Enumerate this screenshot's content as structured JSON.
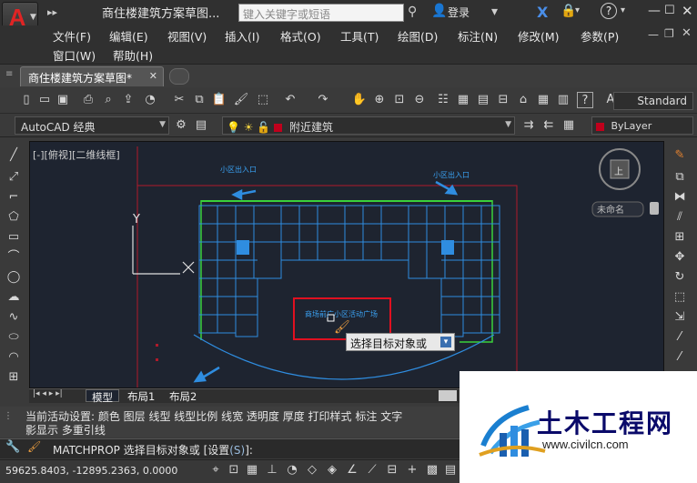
{
  "titlebar": {
    "doc_title": "商住楼建筑方案草图...",
    "search_placeholder": "键入关键字或短语",
    "login": "登录"
  },
  "menu": [
    "文件(F)",
    "编辑(E)",
    "视图(V)",
    "插入(I)",
    "格式(O)",
    "工具(T)",
    "绘图(D)",
    "标注(N)",
    "修改(M)",
    "参数(P)",
    "窗口(W)",
    "帮助(H)"
  ],
  "tabs": {
    "active_doc": "商住楼建筑方案草图*"
  },
  "toolbar": {
    "text_style": "Standard",
    "workspace": "AutoCAD 经典",
    "layer": "附近建筑",
    "color": "ByLayer"
  },
  "viewport": {
    "label": "[-][俯视][二维线框]",
    "y_axis": "Y",
    "entrance_left": "小区出入口",
    "entrance_right": "小区出入口",
    "plaza_label": "商场前广小区活动广场",
    "tooltip": "选择目标对象或",
    "cube_center": "上",
    "wcs": "未命名"
  },
  "layout_tabs": [
    "模型",
    "布局1",
    "布局2"
  ],
  "command": {
    "history_line1": "当前活动设置:  颜色 图层 线型 线型比例 线宽 透明度 厚度 打印样式 标注 文字",
    "history_line2": "影显示 多重引线",
    "prompt_name": "MATCHPROP",
    "prompt_text": "选择目标对象或 [设置",
    "prompt_option": "(S)",
    "prompt_end": "]:"
  },
  "status": {
    "coords": "59625.8403, -12895.2363, 0.0000"
  },
  "watermark": {
    "title": "土木工程网",
    "url": "www.civilcn.com"
  },
  "colors": {
    "accent_red": "#e02424",
    "canvas_bg": "#1e2430",
    "plan_blue": "#2f8de0",
    "plan_green": "#3ad13a"
  }
}
